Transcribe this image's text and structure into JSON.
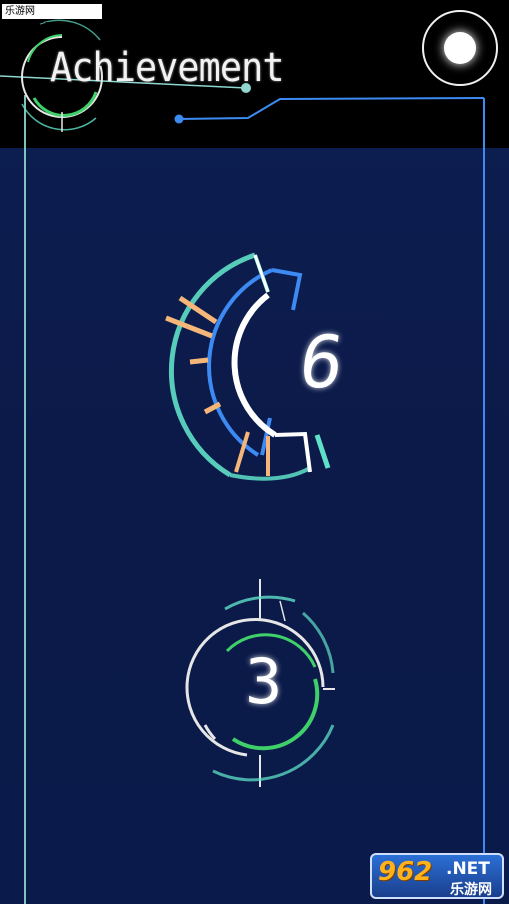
{
  "watermark": "乐游网 www.962.net",
  "header": {
    "title": "Achievement"
  },
  "settings": {
    "icon": "circle-toggle-icon"
  },
  "achievements": [
    {
      "value": "6",
      "colors": [
        "#5fe0c8",
        "#3d8bf2",
        "#ffffff",
        "#f6b67a"
      ]
    },
    {
      "value": "3",
      "colors": [
        "#e6e6e6",
        "#3fd06a",
        "#5fe0c8"
      ]
    }
  ],
  "logo": {
    "brand_number": "962",
    "brand_suffix": ".NET",
    "brand_cn": "乐游网"
  },
  "colors": {
    "line_teal": "#8fd6cf",
    "line_blue": "#3d8bf2",
    "accent_green": "#3fd06a"
  }
}
